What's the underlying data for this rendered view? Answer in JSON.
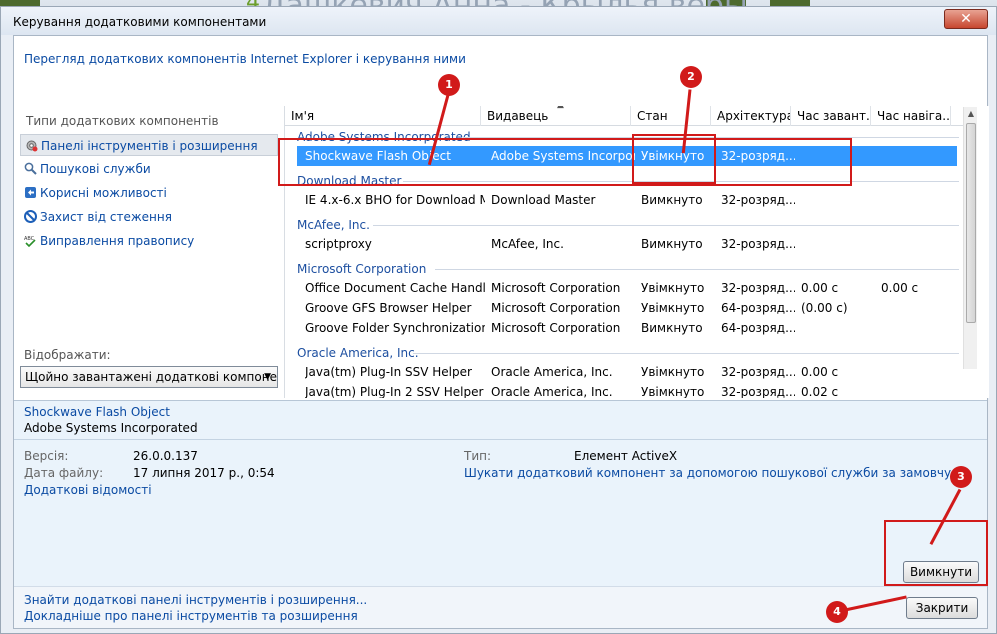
{
  "window": {
    "title": "Керування додатковими компонентами",
    "close_glyph": "✕",
    "header_link": "Перегляд додаткових компонентів Internet Explorer і керування ними"
  },
  "sidebar": {
    "section_label": "Типи додаткових компонентів",
    "items": [
      {
        "label": "Панелі інструментів і розширення",
        "icon": "gear-icon"
      },
      {
        "label": "Пошукові служби",
        "icon": "search-icon"
      },
      {
        "label": "Корисні можливості",
        "icon": "accelerator-icon"
      },
      {
        "label": "Захист від стеження",
        "icon": "tracking-protection-icon"
      },
      {
        "label": "Виправлення правопису",
        "icon": "spelling-icon"
      }
    ],
    "show_label": "Відображати:",
    "show_value": "Щойно завантажені додаткові компоненти"
  },
  "list": {
    "columns": [
      "Ім'я",
      "Видавець",
      "Стан",
      "Архітектура",
      "Час завант...",
      "Час навіга..."
    ],
    "sort_glyph": "▲",
    "groups": [
      {
        "name": "Adobe Systems Incorporated",
        "rows": [
          {
            "name": "Shockwave Flash Object",
            "publisher": "Adobe Systems Incorpor...",
            "status": "Увімкнуто",
            "arch": "32-розряд...",
            "load": "",
            "nav": ""
          }
        ]
      },
      {
        "name": "Download Master",
        "rows": [
          {
            "name": "IE 4.x-6.x BHO for Download M...",
            "publisher": "Download Master",
            "status": "Вимкнуто",
            "arch": "32-розряд...",
            "load": "",
            "nav": ""
          }
        ]
      },
      {
        "name": "McAfee, Inc.",
        "rows": [
          {
            "name": "scriptproxy",
            "publisher": "McAfee, Inc.",
            "status": "Вимкнуто",
            "arch": "32-розряд...",
            "load": "",
            "nav": ""
          }
        ]
      },
      {
        "name": "Microsoft Corporation",
        "rows": [
          {
            "name": "Office Document Cache Handler",
            "publisher": "Microsoft Corporation",
            "status": "Увімкнуто",
            "arch": "32-розряд...",
            "load": "0.00 с",
            "nav": "0.00 с"
          },
          {
            "name": "Groove GFS Browser Helper",
            "publisher": "Microsoft Corporation",
            "status": "Увімкнуто",
            "arch": "64-розряд...",
            "load": "(0.00 с)",
            "nav": ""
          },
          {
            "name": "Groove Folder Synchronization",
            "publisher": "Microsoft Corporation",
            "status": "Вимкнуто",
            "arch": "64-розряд...",
            "load": "",
            "nav": ""
          }
        ]
      },
      {
        "name": "Oracle America, Inc.",
        "rows": [
          {
            "name": "Java(tm) Plug-In SSV Helper",
            "publisher": "Oracle America, Inc.",
            "status": "Увімкнуто",
            "arch": "32-розряд...",
            "load": "0.00 с",
            "nav": ""
          },
          {
            "name": "Java(tm) Plug-In 2 SSV Helper",
            "publisher": "Oracle America, Inc.",
            "status": "Увімкнуто",
            "arch": "32-розряд...",
            "load": "0.02 с",
            "nav": ""
          }
        ]
      }
    ]
  },
  "details": {
    "name": "Shockwave Flash Object",
    "publisher": "Adobe Systems Incorporated",
    "version_label": "Версія:",
    "version_value": "26.0.0.137",
    "date_label": "Дата файлу:",
    "date_value": "17 липня 2017 р., 0:54",
    "more_info": "Додаткові відомості",
    "type_label": "Тип:",
    "type_value": "Елемент ActiveX",
    "search_link": "Шукати додатковий компонент за допомогою пошукової служби за замовчу...",
    "disable_button": "Вимкнути"
  },
  "footer": {
    "link1": "Знайти додаткові панелі інструментів і розширення...",
    "link2": "Докладніше про панелі інструментів та розширення",
    "close_button": "Закрити"
  },
  "background": {
    "title": "Дашкевич Анна - Крылья веры",
    "num": "4"
  },
  "annotations": {
    "markers": [
      "1",
      "2",
      "3",
      "4"
    ],
    "color": "#d11a1a"
  },
  "colors": {
    "link": "#0b4ba3",
    "selection": "#3399ff",
    "details_bg": "#eaf3fb"
  }
}
